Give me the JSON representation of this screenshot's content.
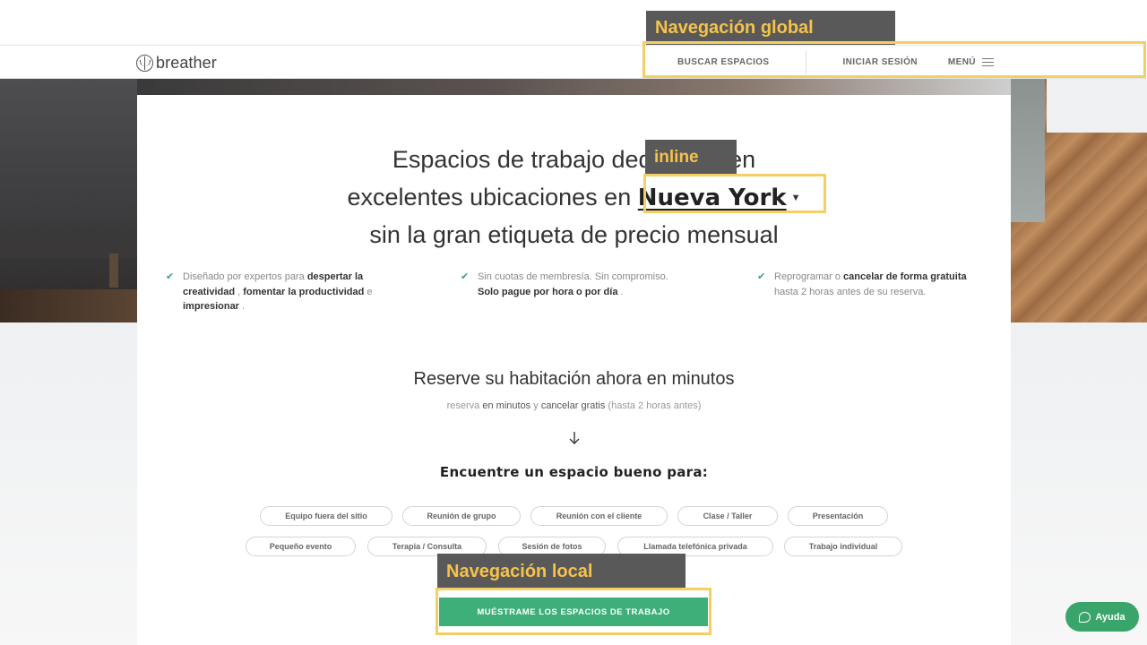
{
  "nav": {
    "logo_text": "breather",
    "search_label": "BUSCAR ESPACIOS",
    "login_label": "INICIAR SESIÓN",
    "menu_label": "MENÚ"
  },
  "hero": {
    "line1": "Espacios de trabajo dedicados en",
    "line2_prefix": "excelentes ubicaciones en ",
    "city": "Nueva York",
    "line3": "sin la gran etiqueta de precio mensual"
  },
  "features": [
    {
      "p1": "Diseñado por expertos para ",
      "b1": "despertar la creatividad",
      "p2": " , ",
      "b2": "fomentar la productividad",
      "p3": " e ",
      "b3": "impresionar",
      "p4": " ."
    },
    {
      "p1": "Sin cuotas de membresía. Sin compromiso.",
      "b1": "Solo pague por hora o por día",
      "p2": " ."
    },
    {
      "p1": "Reprogramar o ",
      "b1": "cancelar de forma gratuita",
      "p2": "hasta 2 horas antes de su reserva."
    }
  ],
  "reserve": {
    "title": "Reserve su habitación ahora en minutos",
    "sub_a": "reserva ",
    "sub_b": "en minutos",
    "sub_c": " y ",
    "sub_d": "cancelar gratis",
    "sub_e": " (hasta 2 horas antes)"
  },
  "find_title": "Encuentre un espacio bueno para:",
  "pills_row1": [
    "Equipo fuera del sitio",
    "Reunión de grupo",
    "Reunión con el cliente",
    "Clase / Taller",
    "Presentación"
  ],
  "pills_row2": [
    "Pequeño evento",
    "Terapia / Consulta",
    "Sesión de fotos",
    "Llamada telefónica privada",
    "Trabajo individual"
  ],
  "cta_label": "MUÉSTRAME LOS ESPACIOS DE TRABAJO",
  "help_label": "Ayuda",
  "annotations": {
    "global": "Navegación global",
    "inline": "inline",
    "local": "Navegación local"
  },
  "colors": {
    "accent_green": "#3faf7a",
    "annotation_yellow": "#f4cf62",
    "annotation_bg": "#595959"
  }
}
